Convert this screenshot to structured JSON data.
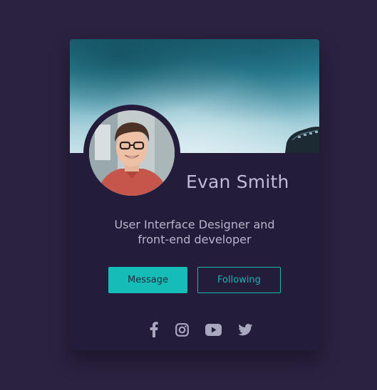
{
  "profile": {
    "name": "Evan Smith",
    "bio_line1": "User Interface Designer and",
    "bio_line2": "front-end developer"
  },
  "actions": {
    "message_label": "Message",
    "following_label": "Following"
  },
  "social": [
    {
      "icon": "facebook-icon"
    },
    {
      "icon": "instagram-icon"
    },
    {
      "icon": "youtube-icon"
    },
    {
      "icon": "twitter-icon"
    }
  ],
  "colors": {
    "page_background": "#2b2141",
    "card_background": "#241c3b",
    "accent": "#16bdb8",
    "name_text": "#c0bbd4",
    "icon": "#a9a6bf"
  }
}
